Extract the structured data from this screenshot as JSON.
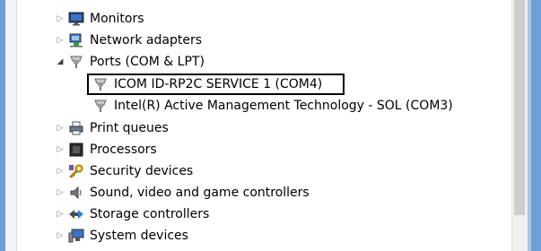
{
  "tree": {
    "items": [
      {
        "label": "Monitors",
        "expander": "▷",
        "icon": "monitor-icon"
      },
      {
        "label": "Network adapters",
        "expander": "▷",
        "icon": "network-adapter-icon"
      },
      {
        "label": "Ports (COM & LPT)",
        "expander": "◢",
        "icon": "port-icon"
      },
      {
        "label": "ICOM ID-RP2C SERVICE 1 (COM4)",
        "expander": "",
        "icon": "port-icon"
      },
      {
        "label": "Intel(R) Active Management Technology - SOL (COM3)",
        "expander": "",
        "icon": "port-icon"
      },
      {
        "label": "Print queues",
        "expander": "▷",
        "icon": "printer-icon"
      },
      {
        "label": "Processors",
        "expander": "▷",
        "icon": "processor-icon"
      },
      {
        "label": "Security devices",
        "expander": "▷",
        "icon": "security-key-icon"
      },
      {
        "label": "Sound, video and game controllers",
        "expander": "▷",
        "icon": "speaker-icon"
      },
      {
        "label": "Storage controllers",
        "expander": "▷",
        "icon": "storage-controller-icon"
      },
      {
        "label": "System devices",
        "expander": "▷",
        "icon": "system-devices-icon"
      }
    ]
  },
  "colors": {
    "frame_blue": "#6d9fd6",
    "selection_border": "#000000"
  }
}
